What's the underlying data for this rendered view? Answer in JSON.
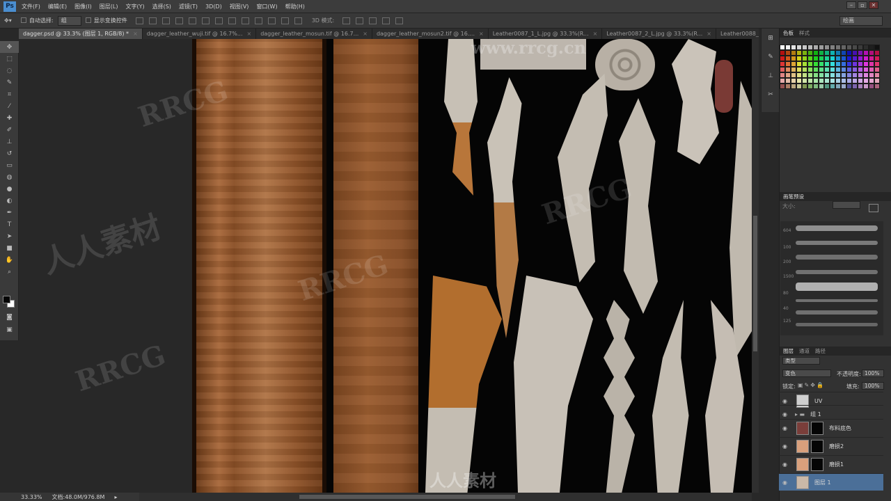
{
  "app": {
    "logo": "Ps"
  },
  "menu": [
    "文件(F)",
    "编辑(E)",
    "图像(I)",
    "图层(L)",
    "文字(Y)",
    "选择(S)",
    "滤镜(T)",
    "3D(D)",
    "视图(V)",
    "窗口(W)",
    "帮助(H)"
  ],
  "options": {
    "auto_select_label": "自动选择:",
    "auto_select_value": "组",
    "transform_label": "显示变换控件",
    "mode_3d": "3D 模式:",
    "workspace": "绘画"
  },
  "watermark": {
    "url": "www.rrcg.cn",
    "brand": "RRCG",
    "cn": "人人素材",
    "logo_text": "人人素材"
  },
  "tabs": [
    "dagger.psd @ 33.3% (图层 1, RGB/8) *",
    "dagger_leather_wuji.tif @ 16.7%...",
    "dagger_leather_mosun.tif @ 16.7...",
    "dagger_leather_mosun2.tif @ 16....",
    "Leather0087_1_L.jpg @ 33.3%(R...",
    "Leather0087_2_L.jpg @ 33.3%(R...",
    "Leather0088_L.jpg @ 50%(RGB/..."
  ],
  "status": {
    "zoom": "33.33%",
    "doc": "文档:48.0M/976.8M"
  },
  "panels": {
    "swatch_tabs": [
      "色板",
      "样式"
    ],
    "brush_tabs": [
      "画笔预设"
    ],
    "brush_size_label": "大小:",
    "brush_sizes": [
      "604",
      "100",
      "200",
      "1500",
      "80",
      "40",
      "125"
    ],
    "layer_tabs": [
      "图层",
      "通道",
      "路径"
    ],
    "kind_filter": "类型",
    "blend_mode": "变色",
    "opacity_label": "不透明度:",
    "opacity_value": "100%",
    "lock_label": "锁定:",
    "fill_label": "填充:",
    "fill_value": "100%"
  },
  "layers": [
    {
      "name": "UV",
      "thumb_color": "#cfcfcf"
    },
    {
      "name": "组 1",
      "thumb_color": "#8a7a55"
    },
    {
      "name": "布料底色",
      "thumb_color": "#7a3e3a"
    },
    {
      "name": "磨损2",
      "thumb_color": "#d9a07c"
    },
    {
      "name": "磨损1",
      "thumb_color": "#d9a07c"
    },
    {
      "name": "图层 1",
      "thumb_color": "#c9b8a8"
    }
  ],
  "colors": {
    "foreground": "#050505",
    "background": "#ffffff",
    "accent": "#4b6f98"
  }
}
